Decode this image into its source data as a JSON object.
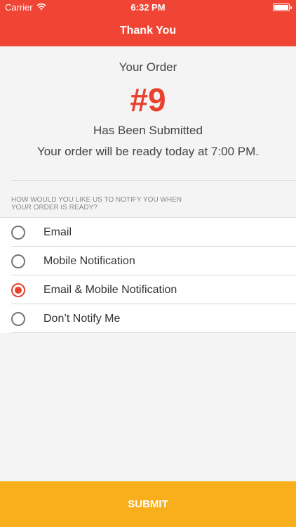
{
  "status_bar": {
    "carrier": "Carrier",
    "time": "6:32 PM",
    "wifi_icon": "wifi-icon",
    "battery_icon": "battery-icon",
    "battery_level": 1.0
  },
  "nav": {
    "title": "Thank You"
  },
  "order": {
    "title": "Your Order",
    "number": "#9",
    "subtitle": "Has Been Submitted",
    "ready_text": "Your order will be ready today at 7:00 PM."
  },
  "notify": {
    "header": "HOW WOULD YOU LIKE US TO NOTIFY YOU WHEN YOUR ORDER IS READY?",
    "options": [
      {
        "label": "Email",
        "selected": false
      },
      {
        "label": "Mobile Notification",
        "selected": false
      },
      {
        "label": "Email & Mobile Notification",
        "selected": true
      },
      {
        "label": "Don’t Notify Me",
        "selected": false
      }
    ]
  },
  "submit": {
    "label": "SUBMIT"
  },
  "colors": {
    "brand_red": "#f04434",
    "accent_red": "#e8412d",
    "submit_yellow": "#f9ae1b"
  }
}
